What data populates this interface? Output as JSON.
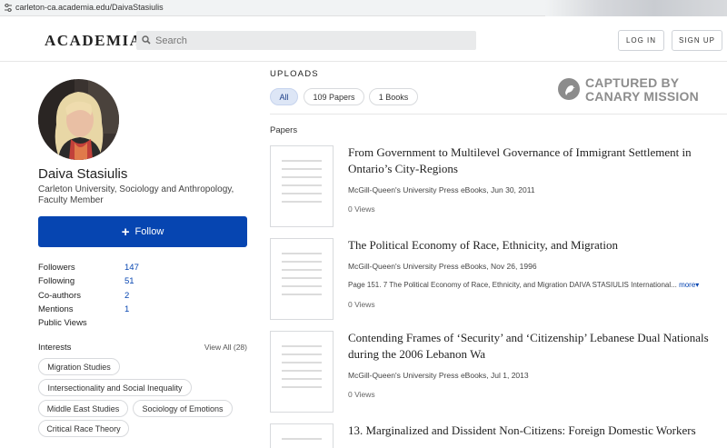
{
  "browser": {
    "url": "carleton-ca.academia.edu/DaivaStasiulis"
  },
  "header": {
    "logo": "ACADEMIA",
    "search_placeholder": "Search",
    "login_label": "LOG IN",
    "signup_label": "SIGN UP"
  },
  "profile": {
    "name": "Daiva Stasiulis",
    "affiliation": "Carleton University, Sociology and Anthropology, Faculty Member",
    "follow_label": "Follow",
    "stats": [
      {
        "label": "Followers",
        "value": "147"
      },
      {
        "label": "Following",
        "value": "51"
      },
      {
        "label": "Co-authors",
        "value": "2"
      },
      {
        "label": "Mentions",
        "value": "1"
      },
      {
        "label": "Public Views",
        "value": ""
      }
    ],
    "interests_label": "Interests",
    "interests_view_all": "View All (28)",
    "interests": [
      "Migration Studies",
      "Intersectionality and Social Inequality",
      "Middle East Studies",
      "Sociology of Emotions",
      "Critical Race Theory"
    ]
  },
  "uploads": {
    "title": "UPLOADS",
    "tabs": [
      {
        "label": "All",
        "active": true
      },
      {
        "label": "109 Papers",
        "active": false
      },
      {
        "label": "1 Books",
        "active": false
      }
    ],
    "papers_label": "Papers",
    "papers": [
      {
        "title": "From Government to Multilevel Governance of Immigrant Settlement in Ontario’s City-Regions",
        "meta": "McGill-Queen's University Press eBooks, Jun 30, 2011",
        "excerpt": "",
        "more": "",
        "views": "0 Views"
      },
      {
        "title": "The Political Economy of Race, Ethnicity, and Migration",
        "meta": "McGill-Queen's University Press eBooks, Nov 26, 1996",
        "excerpt": "Page 151. 7 The Political Economy of Race, Ethnicity, and Migration DAIVA STASIULIS International...",
        "more": "more",
        "views": "0 Views"
      },
      {
        "title": "Contending Frames of ‘Security’ and ‘Citizenship’ Lebanese Dual Nationals during the 2006 Lebanon Wa",
        "meta": "McGill-Queen's University Press eBooks, Jul 1, 2013",
        "excerpt": "",
        "more": "",
        "views": "0 Views"
      },
      {
        "title": "13. Marginalized and Dissident Non-Citizens: Foreign Domestic Workers",
        "meta": "",
        "excerpt": "",
        "more": "",
        "views": ""
      }
    ]
  },
  "watermark": {
    "line1": "CAPTURED BY",
    "line2": "CANARY MISSION"
  }
}
